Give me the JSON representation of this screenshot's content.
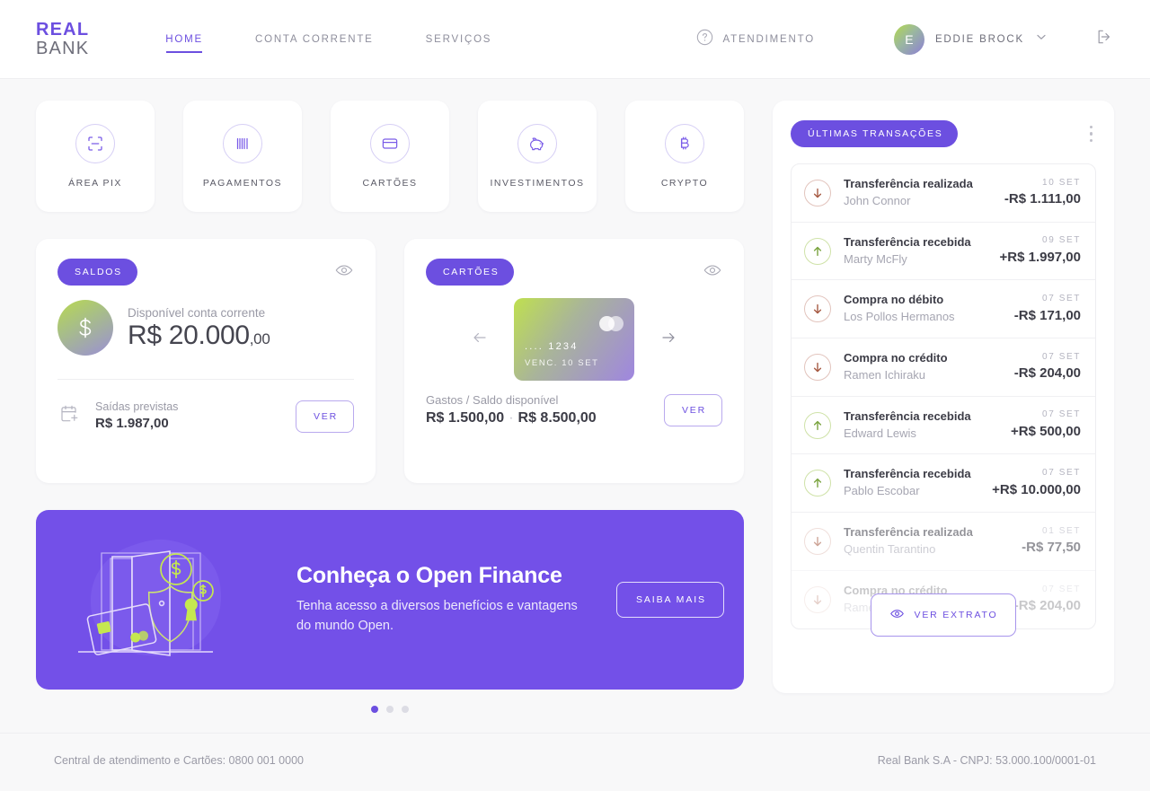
{
  "header": {
    "logo_line1": "REAL",
    "logo_line2": "BANK",
    "nav": [
      {
        "label": "HOME",
        "active": true
      },
      {
        "label": "CONTA CORRENTE",
        "active": false
      },
      {
        "label": "SERVIÇOS",
        "active": false
      }
    ],
    "support_label": "ATENDIMENTO",
    "support_icon": "question-circle-icon",
    "user_initial": "E",
    "user_name": "EDDIE BROCK",
    "chevron_icon": "chevron-down-icon",
    "logout_icon": "logout-icon"
  },
  "quick_actions": [
    {
      "label": "ÁREA PIX",
      "icon": "pix-scan-icon"
    },
    {
      "label": "PAGAMENTOS",
      "icon": "barcode-icon"
    },
    {
      "label": "CARTÕES",
      "icon": "credit-card-icon"
    },
    {
      "label": "INVESTIMENTOS",
      "icon": "piggy-bank-icon"
    },
    {
      "label": "CRYPTO",
      "icon": "bitcoin-icon"
    }
  ],
  "saldos": {
    "badge": "SALDOS",
    "eye_icon": "eye-icon",
    "available_label": "Disponível conta corrente",
    "amount_main": "R$ 20.000",
    "amount_cents": ",00",
    "footer_icon": "calendar-plus-icon",
    "footer_label": "Saídas previstas",
    "footer_value": "R$ 1.987,00",
    "ver_label": "VER"
  },
  "cartoes": {
    "badge": "CARTÕES",
    "eye_icon": "eye-icon",
    "prev_icon": "arrow-left-icon",
    "next_icon": "arrow-right-icon",
    "card_number": ".... 1234",
    "card_expiry": "VENC. 10 SET",
    "footer_label": "Gastos / Saldo disponível",
    "spent": "R$ 1.500,00",
    "separator": "·",
    "available": "R$ 8.500,00",
    "ver_label": "VER"
  },
  "banner": {
    "title": "Conheça o Open Finance",
    "subtitle": "Tenha acesso a diversos benefícios e vantagens do mundo Open.",
    "cta_label": "SAIBA MAIS",
    "illustration": "open-door-shield-card-coins-illustration",
    "dots": [
      true,
      false,
      false
    ],
    "bg_color": "#7350e8",
    "accent_color": "#c5e84f"
  },
  "transactions": {
    "badge": "ÚLTIMAS TRANSAÇÕES",
    "menu_icon": "kebab-menu-icon",
    "extrato_label": "VER EXTRATO",
    "extrato_icon": "eye-icon",
    "rows": [
      {
        "title": "Transferência realizada",
        "sub": "John Connor",
        "date": "10 SET",
        "amount": "-R$ 1.111,00",
        "dir": "out"
      },
      {
        "title": "Transferência recebida",
        "sub": "Marty McFly",
        "date": "09 SET",
        "amount": "+R$ 1.997,00",
        "dir": "in"
      },
      {
        "title": "Compra no débito",
        "sub": "Los Pollos Hermanos",
        "date": "07 SET",
        "amount": "-R$ 171,00",
        "dir": "out"
      },
      {
        "title": "Compra no crédito",
        "sub": "Ramen Ichiraku",
        "date": "07 SET",
        "amount": "-R$ 204,00",
        "dir": "out"
      },
      {
        "title": "Transferência recebida",
        "sub": "Edward Lewis",
        "date": "07 SET",
        "amount": "+R$ 500,00",
        "dir": "in"
      },
      {
        "title": "Transferência recebida",
        "sub": "Pablo Escobar",
        "date": "07 SET",
        "amount": "+R$ 10.000,00",
        "dir": "in"
      },
      {
        "title": "Transferência realizada",
        "sub": "Quentin Tarantino",
        "date": "01 SET",
        "amount": "-R$ 77,50",
        "dir": "out"
      },
      {
        "title": "Compra no crédito",
        "sub": "Ramen Ichiraku",
        "date": "07 SET",
        "amount": "-R$ 204,00",
        "dir": "out"
      }
    ]
  },
  "footer": {
    "left": "Central de atendimento e Cartões: 0800 001 0000",
    "right": "Real Bank S.A - CNPJ: 53.000.100/0001-01"
  },
  "colors": {
    "accent_purple": "#6c4fe0",
    "banner_purple": "#7350e8",
    "lime": "#c5e84f",
    "page_bg": "#f8f8f9"
  }
}
